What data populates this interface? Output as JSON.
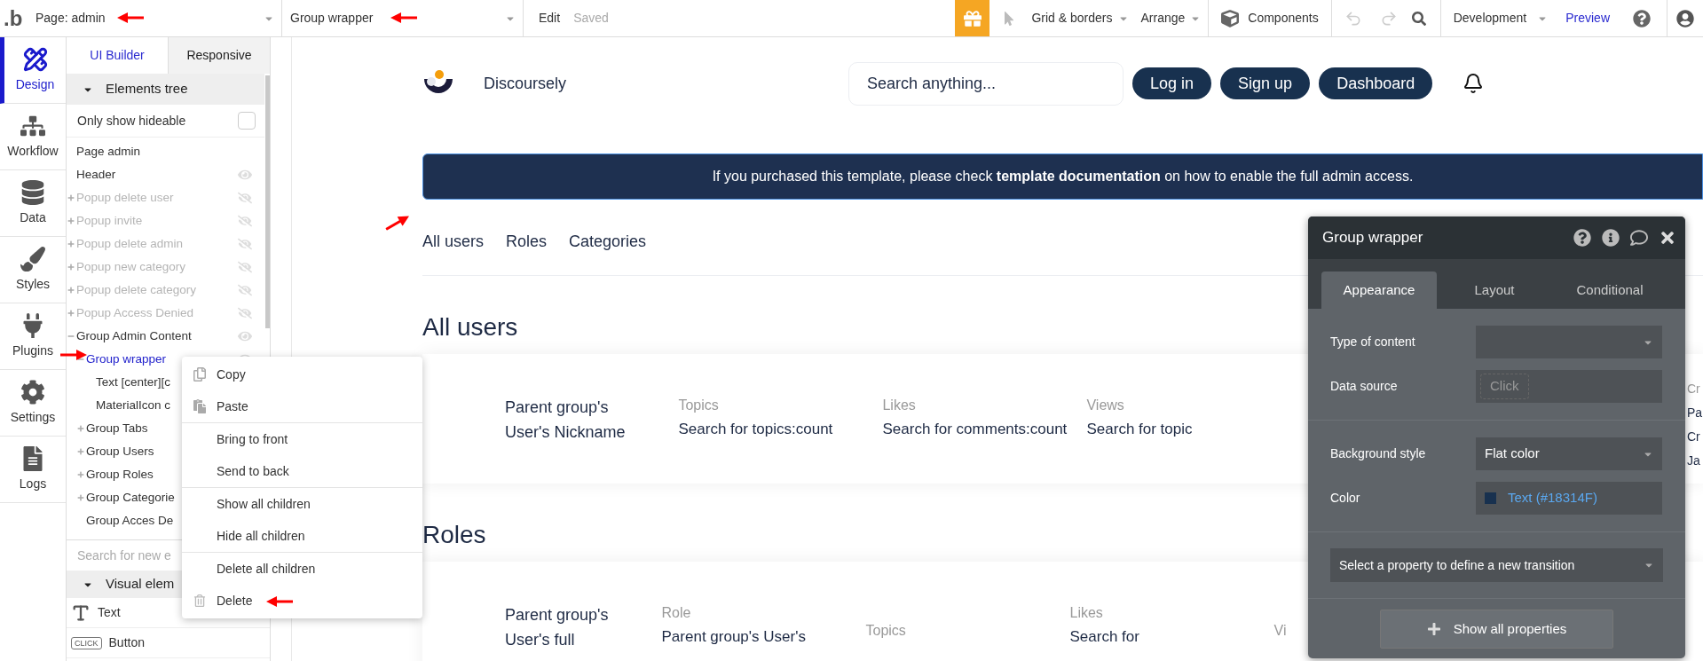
{
  "top_bar": {
    "logo": ".b",
    "page_select": "Page: admin",
    "element_select": "Group wrapper",
    "edit": "Edit",
    "status": "Saved",
    "grid": "Grid & borders",
    "arrange": "Arrange",
    "components": "Components",
    "mode": "Development",
    "preview": "Preview"
  },
  "sidebar": {
    "items": [
      {
        "label": "Design",
        "kind": "design",
        "selected": true
      },
      {
        "label": "Workflow",
        "kind": "workflow",
        "selected": false
      },
      {
        "label": "Data",
        "kind": "data",
        "selected": false
      },
      {
        "label": "Styles",
        "kind": "styles",
        "selected": false
      },
      {
        "label": "Plugins",
        "kind": "plugins",
        "selected": false
      },
      {
        "label": "Settings",
        "kind": "settings",
        "selected": false
      },
      {
        "label": "Logs",
        "kind": "logs",
        "selected": false
      }
    ]
  },
  "elements_panel": {
    "tabs": [
      {
        "label": "UI Builder",
        "selected": true
      },
      {
        "label": "Responsive",
        "selected": false
      }
    ],
    "tree_header": "Elements tree",
    "hideable": {
      "label": "Only show hideable",
      "checked": false
    },
    "tree": [
      {
        "label": "Page admin",
        "selected": false
      },
      {
        "label": "Header",
        "selected": false,
        "visible": true
      },
      {
        "label": "Popup delete user",
        "selected": false,
        "visible": false,
        "expanded": false
      },
      {
        "label": "Popup invite",
        "selected": false,
        "visible": false,
        "expanded": false
      },
      {
        "label": "Popup delete admin",
        "selected": false,
        "visible": false,
        "expanded": false
      },
      {
        "label": "Popup new category",
        "selected": false,
        "visible": false,
        "expanded": false
      },
      {
        "label": "Popup delete category",
        "selected": false,
        "visible": false,
        "expanded": false
      },
      {
        "label": "Popup Access Denied",
        "selected": false,
        "visible": false,
        "expanded": false
      },
      {
        "label": "Group Admin Content",
        "selected": false,
        "visible": true,
        "expanded": true,
        "children": [
          {
            "label": "Group wrapper",
            "selected": true,
            "visible": true,
            "expanded": true,
            "children": [
              {
                "label": "Text [center][c",
                "selected": false
              },
              {
                "label": "MaterialIcon c",
                "selected": false
              }
            ]
          },
          {
            "label": "Group Tabs",
            "selected": false,
            "expanded": false
          },
          {
            "label": "Group Users",
            "selected": false,
            "expanded": false
          },
          {
            "label": "Group Roles",
            "selected": false,
            "expanded": false
          },
          {
            "label": "Group Categorie",
            "selected": false,
            "expanded": false
          },
          {
            "label": "Group Acces De",
            "selected": false
          }
        ]
      }
    ],
    "search": {
      "placeholder": "Search for new e"
    },
    "visual_header": "Visual elem",
    "elements": [
      {
        "label": "Text",
        "kind": "text"
      },
      {
        "label": "Button",
        "kind": "button",
        "badge": "CLICK"
      }
    ]
  },
  "context_menu": {
    "groups": [
      [
        {
          "label": "Copy",
          "kind": "copy"
        },
        {
          "label": "Paste",
          "kind": "paste"
        }
      ],
      [
        {
          "label": "Bring to front",
          "kind": "plain"
        },
        {
          "label": "Send to back",
          "kind": "plain"
        }
      ],
      [
        {
          "label": "Show all children",
          "kind": "plain"
        },
        {
          "label": "Hide all children",
          "kind": "plain"
        }
      ],
      [
        {
          "label": "Delete all children",
          "kind": "plain"
        },
        {
          "label": "Delete",
          "kind": "delete"
        }
      ]
    ]
  },
  "canvas": {
    "brand": "Discoursely",
    "search": {
      "placeholder": "Search anything..."
    },
    "buttons": [
      "Log in",
      "Sign up",
      "Dashboard"
    ],
    "banner": "If you purchased this template, please check **template documentation** on how to enable the full admin access.",
    "tabs": [
      "All users",
      "Roles",
      "Categories"
    ],
    "sections": [
      {
        "title": "All users",
        "name_lines": [
          "Parent group's",
          "User's Nickname"
        ],
        "columns": [
          {
            "label": "Topics",
            "value": "Search for topics:count"
          },
          {
            "label": "Likes",
            "value": "Search for comments:count"
          },
          {
            "label": "Views",
            "value": "Search for topic"
          }
        ],
        "edge_column": {
          "label": "Cr",
          "values": [
            "Pa",
            "Cr",
            "Ja"
          ]
        }
      },
      {
        "title": "Roles",
        "name_lines": [
          "Parent group's",
          "User's full"
        ],
        "columns": [
          {
            "label": "Role",
            "value": "Parent group's User's"
          },
          {
            "label": "Topics"
          },
          {
            "label": "Likes",
            "value": "Search for"
          },
          {
            "label": "Vi"
          }
        ]
      }
    ]
  },
  "property_panel": {
    "title": "Group wrapper",
    "tabs": [
      {
        "label": "Appearance",
        "selected": true
      },
      {
        "label": "Layout",
        "selected": false
      },
      {
        "label": "Conditional",
        "selected": false
      }
    ],
    "groups": [
      [
        {
          "label": "Type of content",
          "kind": "dropdown"
        },
        {
          "label": "Data source",
          "kind": "expression",
          "button": "Click"
        }
      ],
      [
        {
          "label": "Background style",
          "kind": "dropdown",
          "value": "Flat color"
        },
        {
          "label": "Color",
          "kind": "color",
          "value": "Text (#18314F)",
          "color": "#18314F"
        }
      ]
    ],
    "transition": "Select a property to define a new transition",
    "show_all": "Show all properties"
  }
}
